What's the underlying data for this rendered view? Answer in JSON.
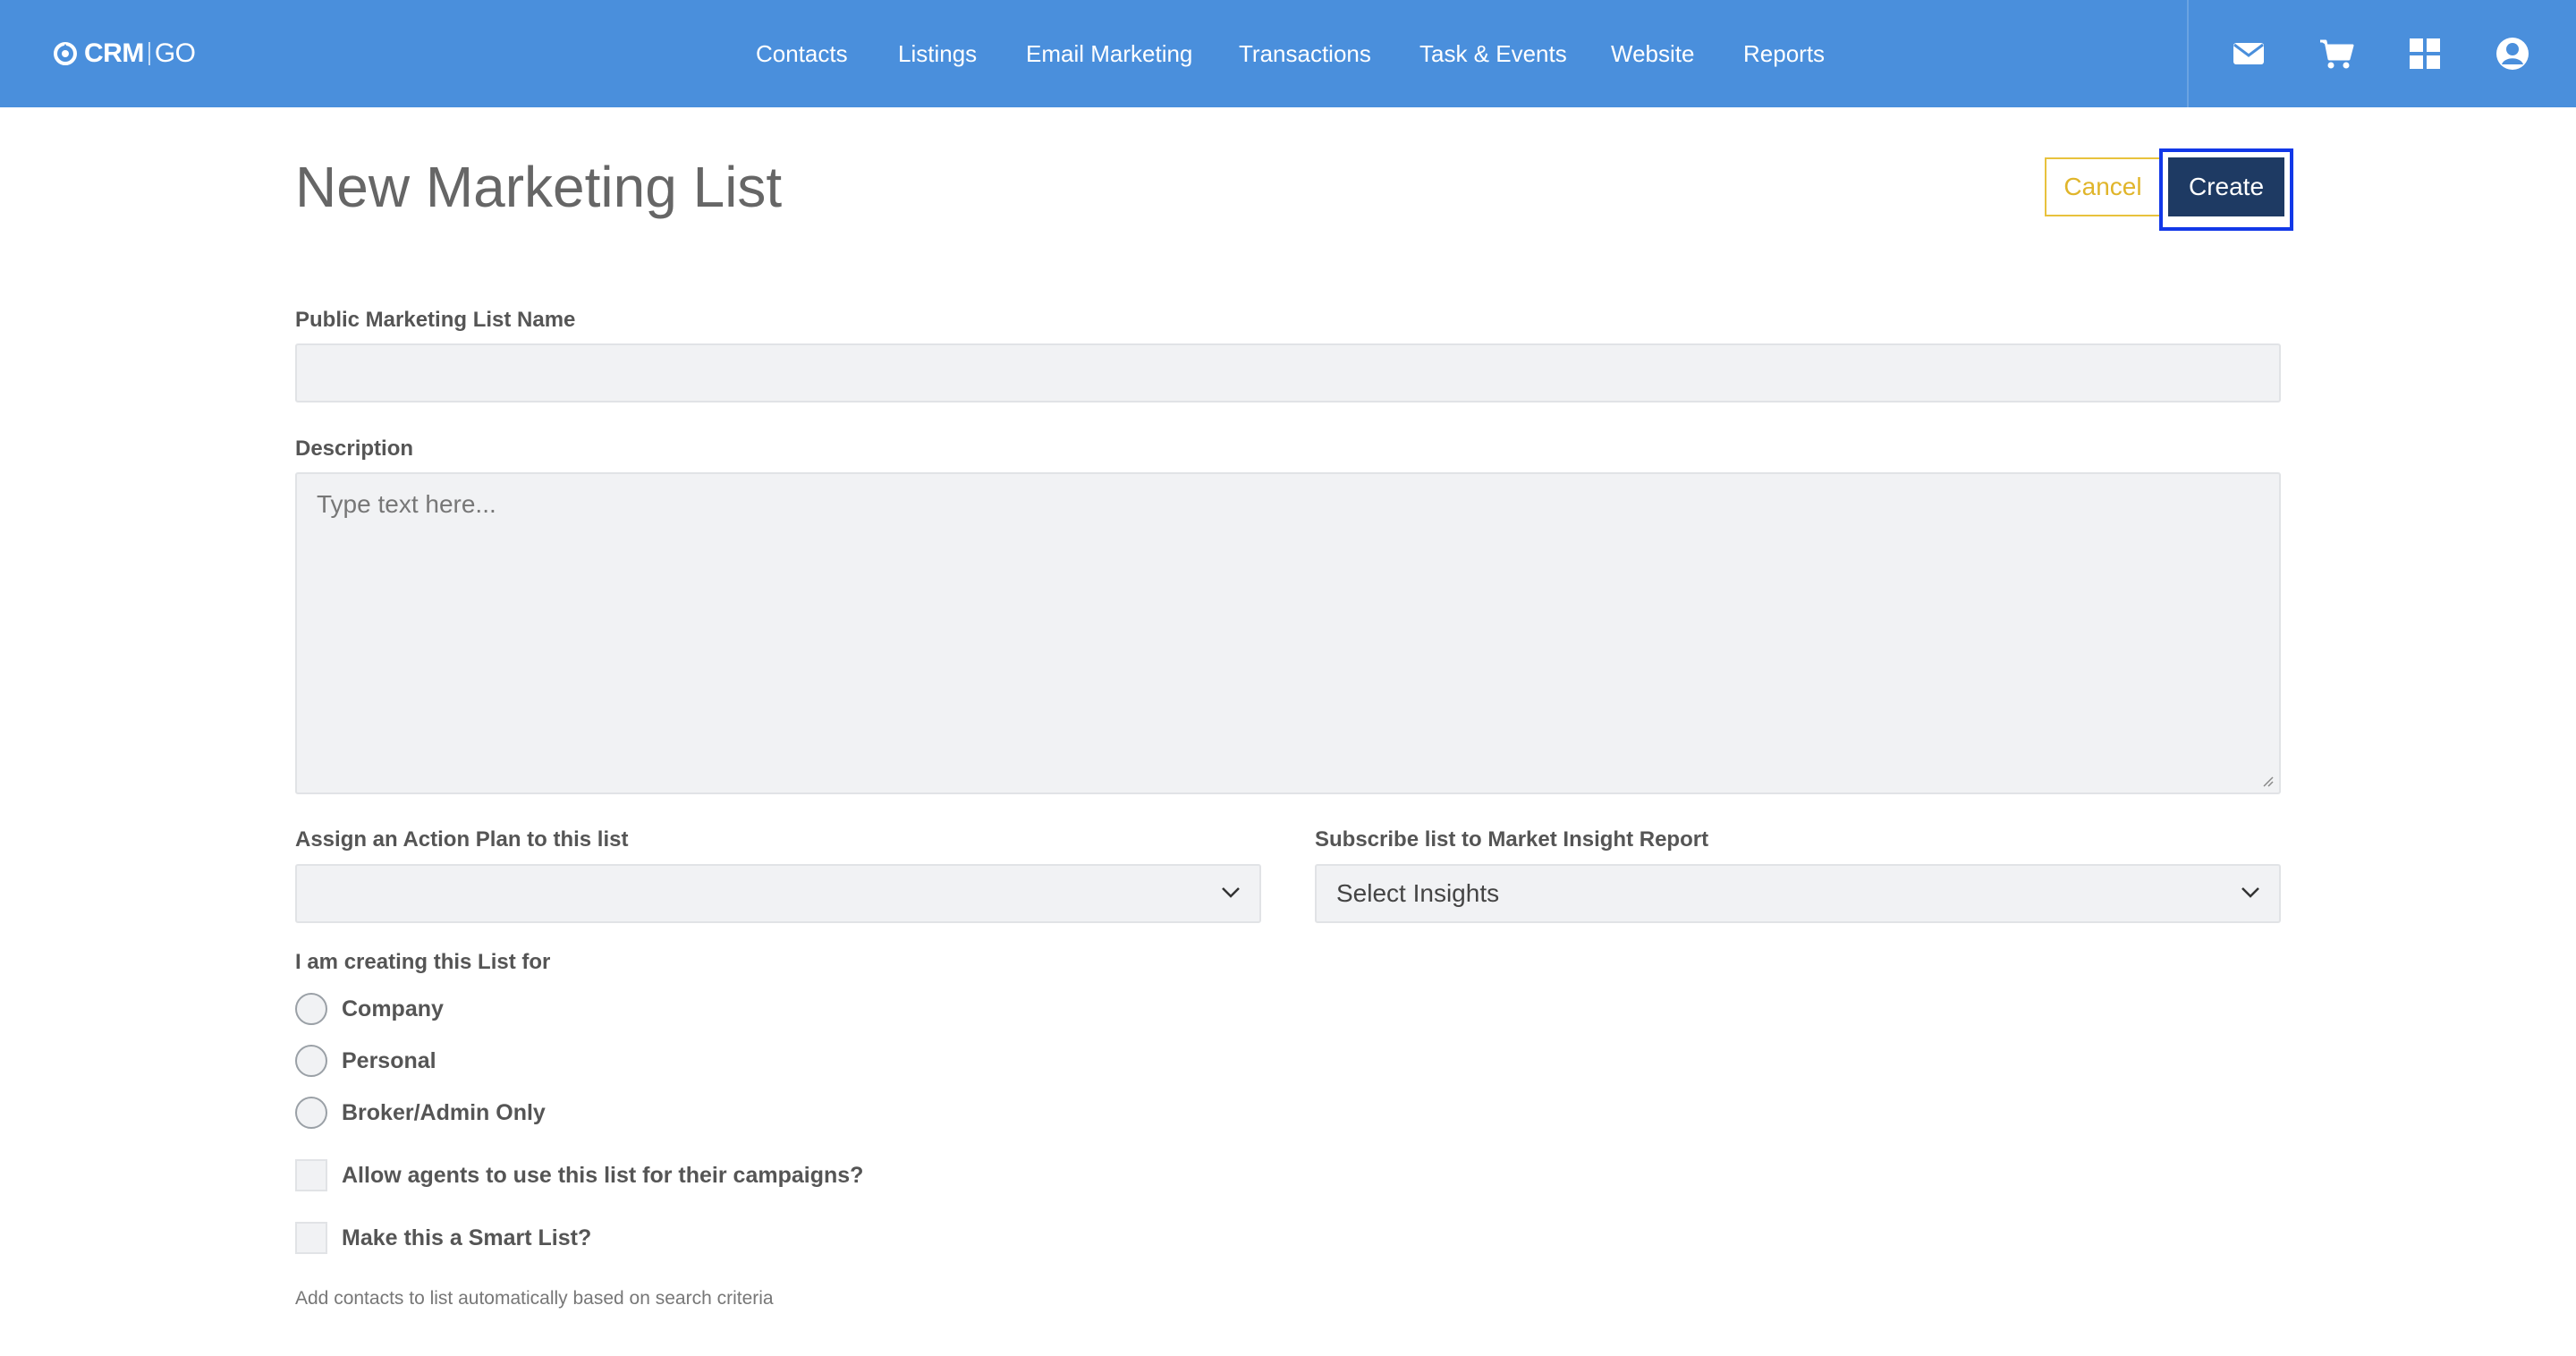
{
  "brand": {
    "crm": "CRM",
    "go": "GO"
  },
  "nav": [
    "Contacts",
    "Listings",
    "Email Marketing",
    "Transactions",
    "Task & Events",
    "Website",
    "Reports"
  ],
  "top_icons": [
    "envelope-icon",
    "cart-icon",
    "apps-grid-icon",
    "user-account-icon"
  ],
  "page": {
    "title": "New Marketing List",
    "cancel_label": "Cancel",
    "create_label": "Create"
  },
  "form": {
    "name_label": "Public Marketing List Name",
    "name_value": "",
    "description_label": "Description",
    "description_placeholder": "Type text here...",
    "action_plan_label": "Assign an Action Plan to this list",
    "action_plan_value": "",
    "insight_label": "Subscribe list to Market Insight Report",
    "insight_value": "Select Insights",
    "creating_for_label": "I am creating this List for",
    "options": [
      "Company",
      "Personal",
      "Broker/Admin Only"
    ],
    "allow_agents_label": "Allow agents to use this list for their campaigns?",
    "smart_list_label": "Make this a Smart List?",
    "smart_list_help": "Add contacts to list automatically based on search criteria"
  },
  "colors": {
    "topbar": "#4a8fdc",
    "create_button": "#1e3a63",
    "cancel_border": "#e8c23d",
    "focus_outline": "#1238e8"
  }
}
